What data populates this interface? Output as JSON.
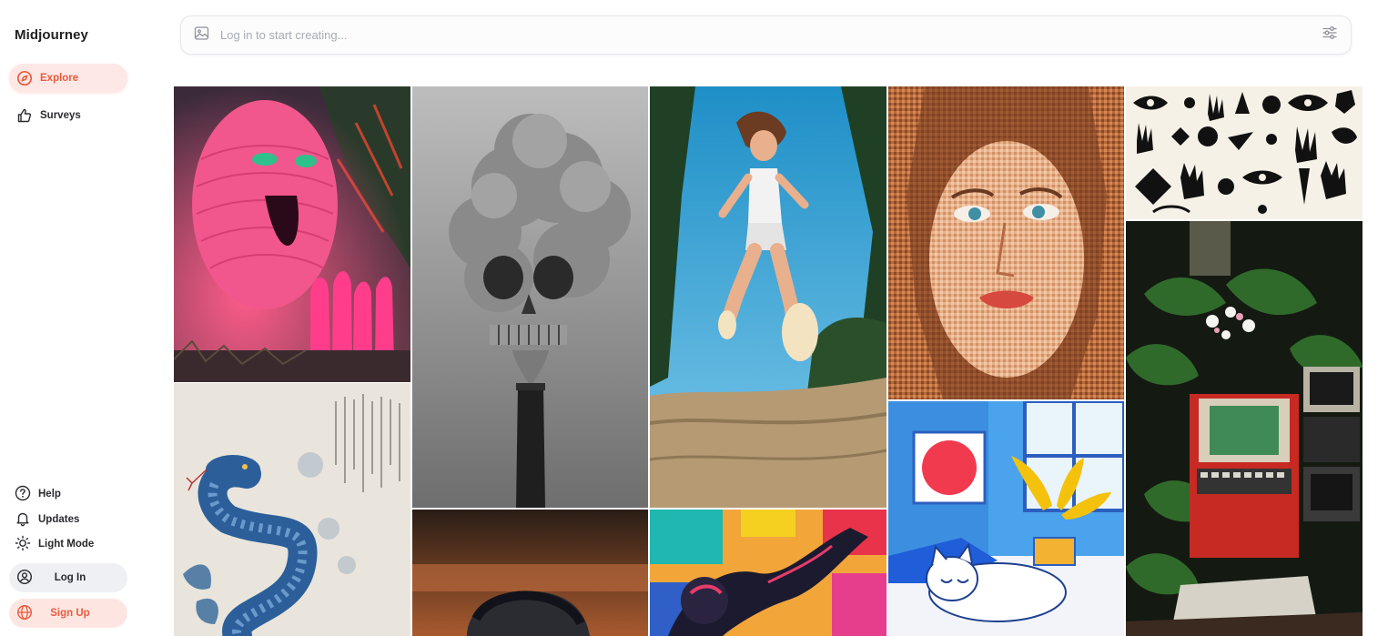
{
  "app": {
    "title": "Midjourney"
  },
  "nav": {
    "explore": "Explore",
    "surveys": "Surveys"
  },
  "bottom": {
    "help": "Help",
    "updates": "Updates",
    "light_mode": "Light Mode",
    "log_in": "Log In",
    "sign_up": "Sign Up"
  },
  "search": {
    "placeholder": "Log in to start creating..."
  },
  "colors": {
    "accent": "#ec5a3d",
    "active_bg": "#fde8e6"
  },
  "gallery": {
    "items": [
      "pink-monster-in-smoke",
      "skull-smoke-from-chimney",
      "girl-jumping-into-sand",
      "mosaic-face-portrait",
      "black-symbols-hands-eyes",
      "blue-snake-ink-painting",
      "retro-computers-in-jungle",
      "man-portrait-wood-background",
      "colorful-pop-art-figure",
      "white-cat-sleeping-illustration"
    ]
  }
}
